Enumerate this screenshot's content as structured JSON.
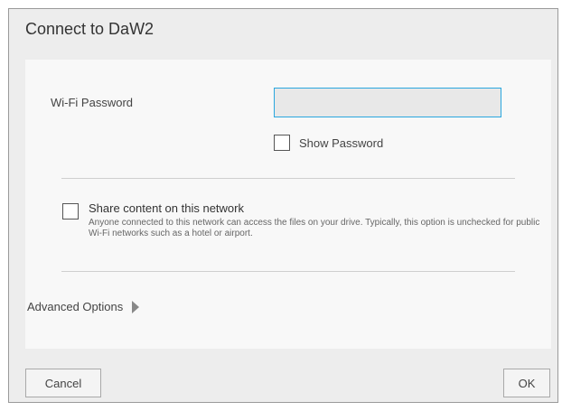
{
  "dialog": {
    "title": "Connect to DaW2",
    "password_label": "Wi-Fi Password",
    "password_value": "",
    "show_password_label": "Show Password",
    "share_title": "Share content on this network",
    "share_description": "Anyone connected to this network can access the files on your drive. Typically, this option is unchecked for public Wi-Fi networks such as a hotel or airport.",
    "advanced_label": "Advanced Options",
    "cancel_label": "Cancel",
    "ok_label": "OK"
  },
  "colors": {
    "input_focus_border": "#2aa7df",
    "dialog_background": "#ededed",
    "panel_background": "#f8f8f8"
  },
  "icons": {
    "advanced_toggle": "triangle-right-icon"
  }
}
